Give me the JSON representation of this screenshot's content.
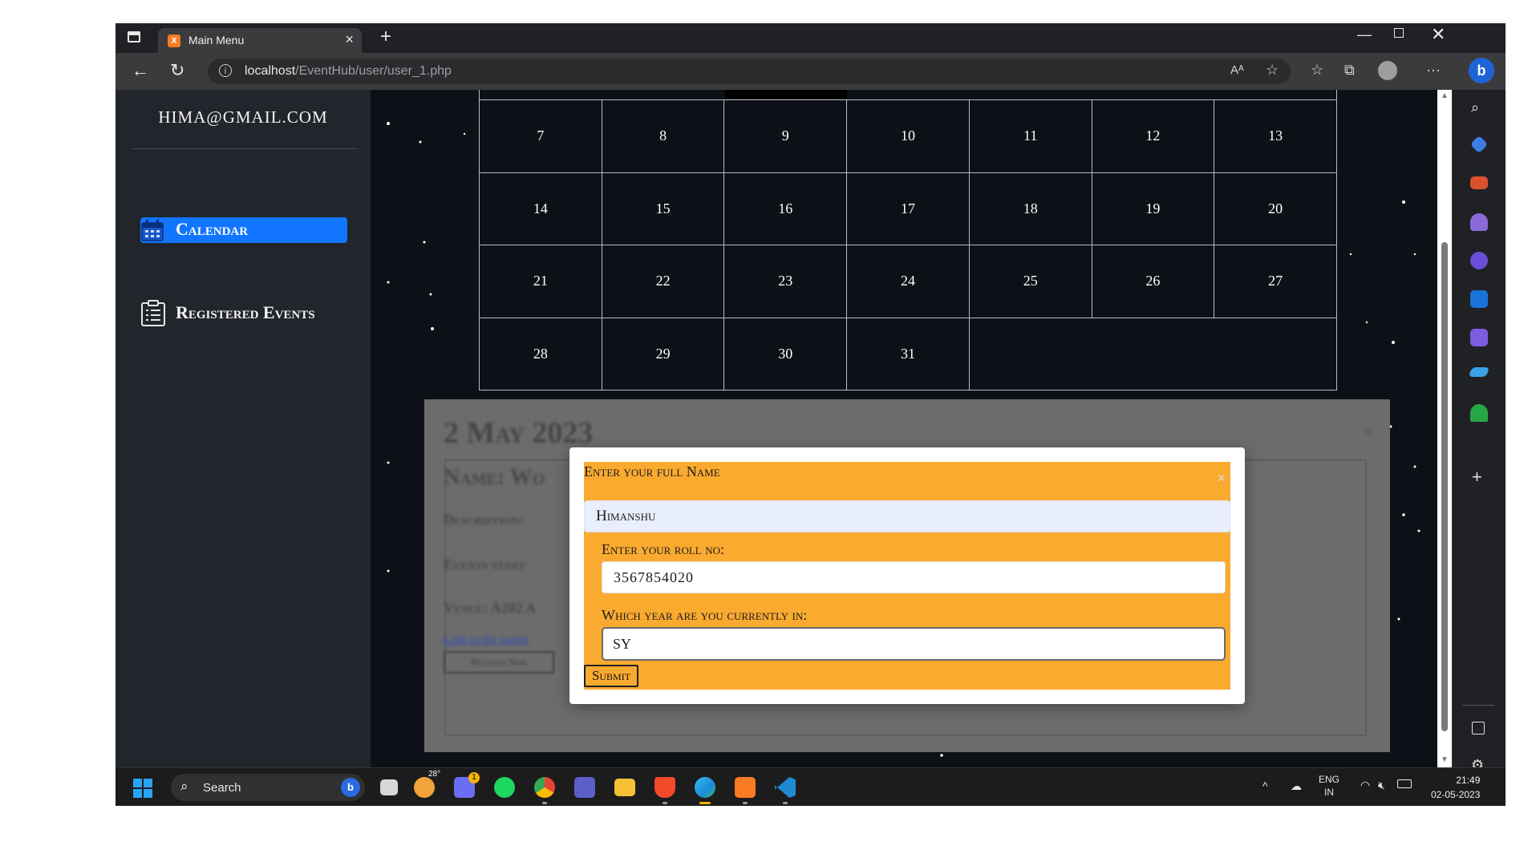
{
  "browser": {
    "tab_title": "Main Menu",
    "favicon_letter": "X",
    "url_host": "localhost",
    "url_path": "/EventHub/user/user_1.php"
  },
  "sidebar": {
    "email": "HIMA@GMAIL.COM",
    "items": [
      {
        "label": "Calendar",
        "icon": "calendar-icon",
        "active": true
      },
      {
        "label": "Registered Events",
        "icon": "clipboard-list-icon",
        "active": false
      }
    ]
  },
  "calendar": {
    "days": [
      "7",
      "8",
      "9",
      "10",
      "11",
      "12",
      "13",
      "14",
      "15",
      "16",
      "17",
      "18",
      "19",
      "20",
      "21",
      "22",
      "23",
      "24",
      "25",
      "26",
      "27",
      "28",
      "29",
      "30",
      "31"
    ]
  },
  "event_panel": {
    "date": "2 May 2023",
    "name_label": "Name: Wo",
    "description_label": "Description:",
    "start_label": "Events start",
    "venue_label": "Venue: A202 A",
    "link_text": "Link to the poster",
    "register_button": "Register Now"
  },
  "form": {
    "name_label": "Enter your full Name",
    "name_value": "Himanshu",
    "roll_label": "Enter your roll no:",
    "roll_value": "3567854020",
    "year_label": "Which year are you currently in:",
    "year_value": "SY",
    "submit_label": "Submit",
    "close_symbol": "×"
  },
  "taskbar": {
    "search_placeholder": "Search",
    "weather_temp": "28°",
    "chat_badge": "1",
    "language": "ENG",
    "region": "IN",
    "time": "21:49",
    "date": "02-05-2023"
  },
  "colors": {
    "accent_blue": "#1275ff",
    "form_orange": "#fbaa30",
    "page_bg": "#0d1117",
    "sidebar_bg": "#22252b"
  }
}
